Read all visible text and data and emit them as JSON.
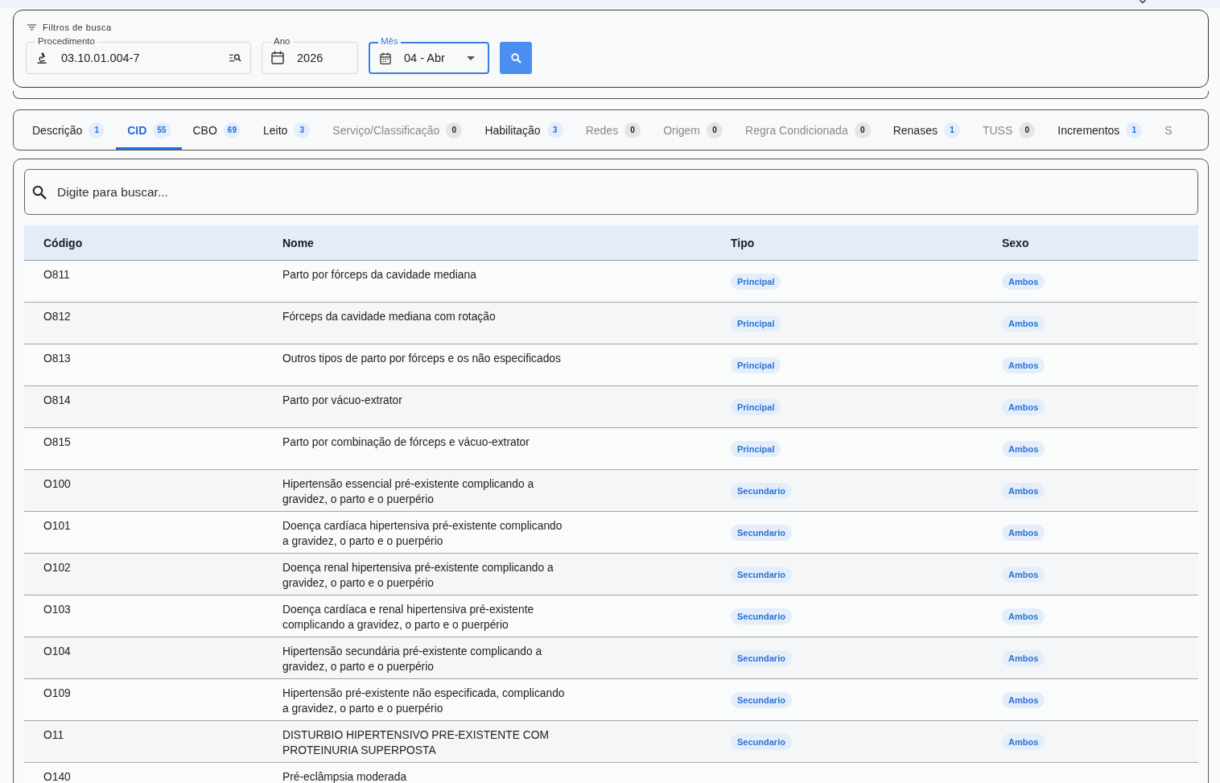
{
  "filters": {
    "title": "Filtros de busca",
    "fields": [
      {
        "kind": "procedure",
        "label": "Procedimento",
        "value": "03.10.01.004-7",
        "focused": false
      },
      {
        "kind": "year",
        "label": "Ano",
        "value": "2026",
        "focused": false
      },
      {
        "kind": "month",
        "label": "Mês",
        "value": "04 - Abr",
        "focused": true
      }
    ]
  },
  "tabs": [
    {
      "label": "Descrição",
      "count": "1",
      "selected": false,
      "disabled": false
    },
    {
      "label": "CID",
      "count": "55",
      "selected": true,
      "disabled": false
    },
    {
      "label": "CBO",
      "count": "69",
      "selected": false,
      "disabled": false
    },
    {
      "label": "Leito",
      "count": "3",
      "selected": false,
      "disabled": false
    },
    {
      "label": "Serviço/Classificação",
      "count": "0",
      "selected": false,
      "disabled": true
    },
    {
      "label": "Habilitação",
      "count": "3",
      "selected": false,
      "disabled": false
    },
    {
      "label": "Redes",
      "count": "0",
      "selected": false,
      "disabled": true
    },
    {
      "label": "Origem",
      "count": "0",
      "selected": false,
      "disabled": true
    },
    {
      "label": "Regra Condicionada",
      "count": "0",
      "selected": false,
      "disabled": true
    },
    {
      "label": "Renases",
      "count": "1",
      "selected": false,
      "disabled": false
    },
    {
      "label": "TUSS",
      "count": "0",
      "selected": false,
      "disabled": true
    },
    {
      "label": "Incrementos",
      "count": "1",
      "selected": false,
      "disabled": false
    },
    {
      "label": "S",
      "selected": false,
      "disabled": true
    }
  ],
  "search": {
    "placeholder": "Digite para buscar..."
  },
  "table": {
    "columns": [
      "Código",
      "Nome",
      "Tipo",
      "Sexo"
    ],
    "rows": [
      {
        "code": "O811",
        "name": "Parto por fórceps da cavidade mediana",
        "type": "Principal",
        "sex": "Ambos"
      },
      {
        "code": "O812",
        "name": "Fórceps da cavidade mediana com rotação",
        "type": "Principal",
        "sex": "Ambos"
      },
      {
        "code": "O813",
        "name": "Outros tipos de parto por fórceps e os não especificados",
        "type": "Principal",
        "sex": "Ambos"
      },
      {
        "code": "O814",
        "name": "Parto por vácuo-extrator",
        "type": "Principal",
        "sex": "Ambos"
      },
      {
        "code": "O815",
        "name": "Parto por combinação de fórceps e vácuo-extrator",
        "type": "Principal",
        "sex": "Ambos"
      },
      {
        "code": "O100",
        "name": "Hipertensão essencial pré-existente complicando a gravidez, o parto e o puerpério",
        "type": "Secundario",
        "sex": "Ambos"
      },
      {
        "code": "O101",
        "name": "Doença cardíaca hipertensiva pré-existente complicando a gravidez, o parto e o puerpério",
        "type": "Secundario",
        "sex": "Ambos"
      },
      {
        "code": "O102",
        "name": "Doença renal hipertensiva pré-existente complicando a gravidez, o parto e o puerpério",
        "type": "Secundario",
        "sex": "Ambos"
      },
      {
        "code": "O103",
        "name": "Doença cardíaca e renal hipertensiva pré-existente complicando a gravidez, o parto e o puerpério",
        "type": "Secundario",
        "sex": "Ambos"
      },
      {
        "code": "O104",
        "name": "Hipertensão secundária pré-existente complicando a gravidez, o parto e o puerpério",
        "type": "Secundario",
        "sex": "Ambos"
      },
      {
        "code": "O109",
        "name": "Hipertensão pré-existente não especificada, complicando a gravidez, o parto e o puerpério",
        "type": "Secundario",
        "sex": "Ambos"
      },
      {
        "code": "O11",
        "name": "DISTURBIO HIPERTENSIVO PRE-EXISTENTE COM PROTEINURIA SUPERPOSTA",
        "type": "Secundario",
        "sex": "Ambos"
      },
      {
        "code": "O140",
        "name": "Pré-eclâmpsia moderada"
      }
    ]
  }
}
